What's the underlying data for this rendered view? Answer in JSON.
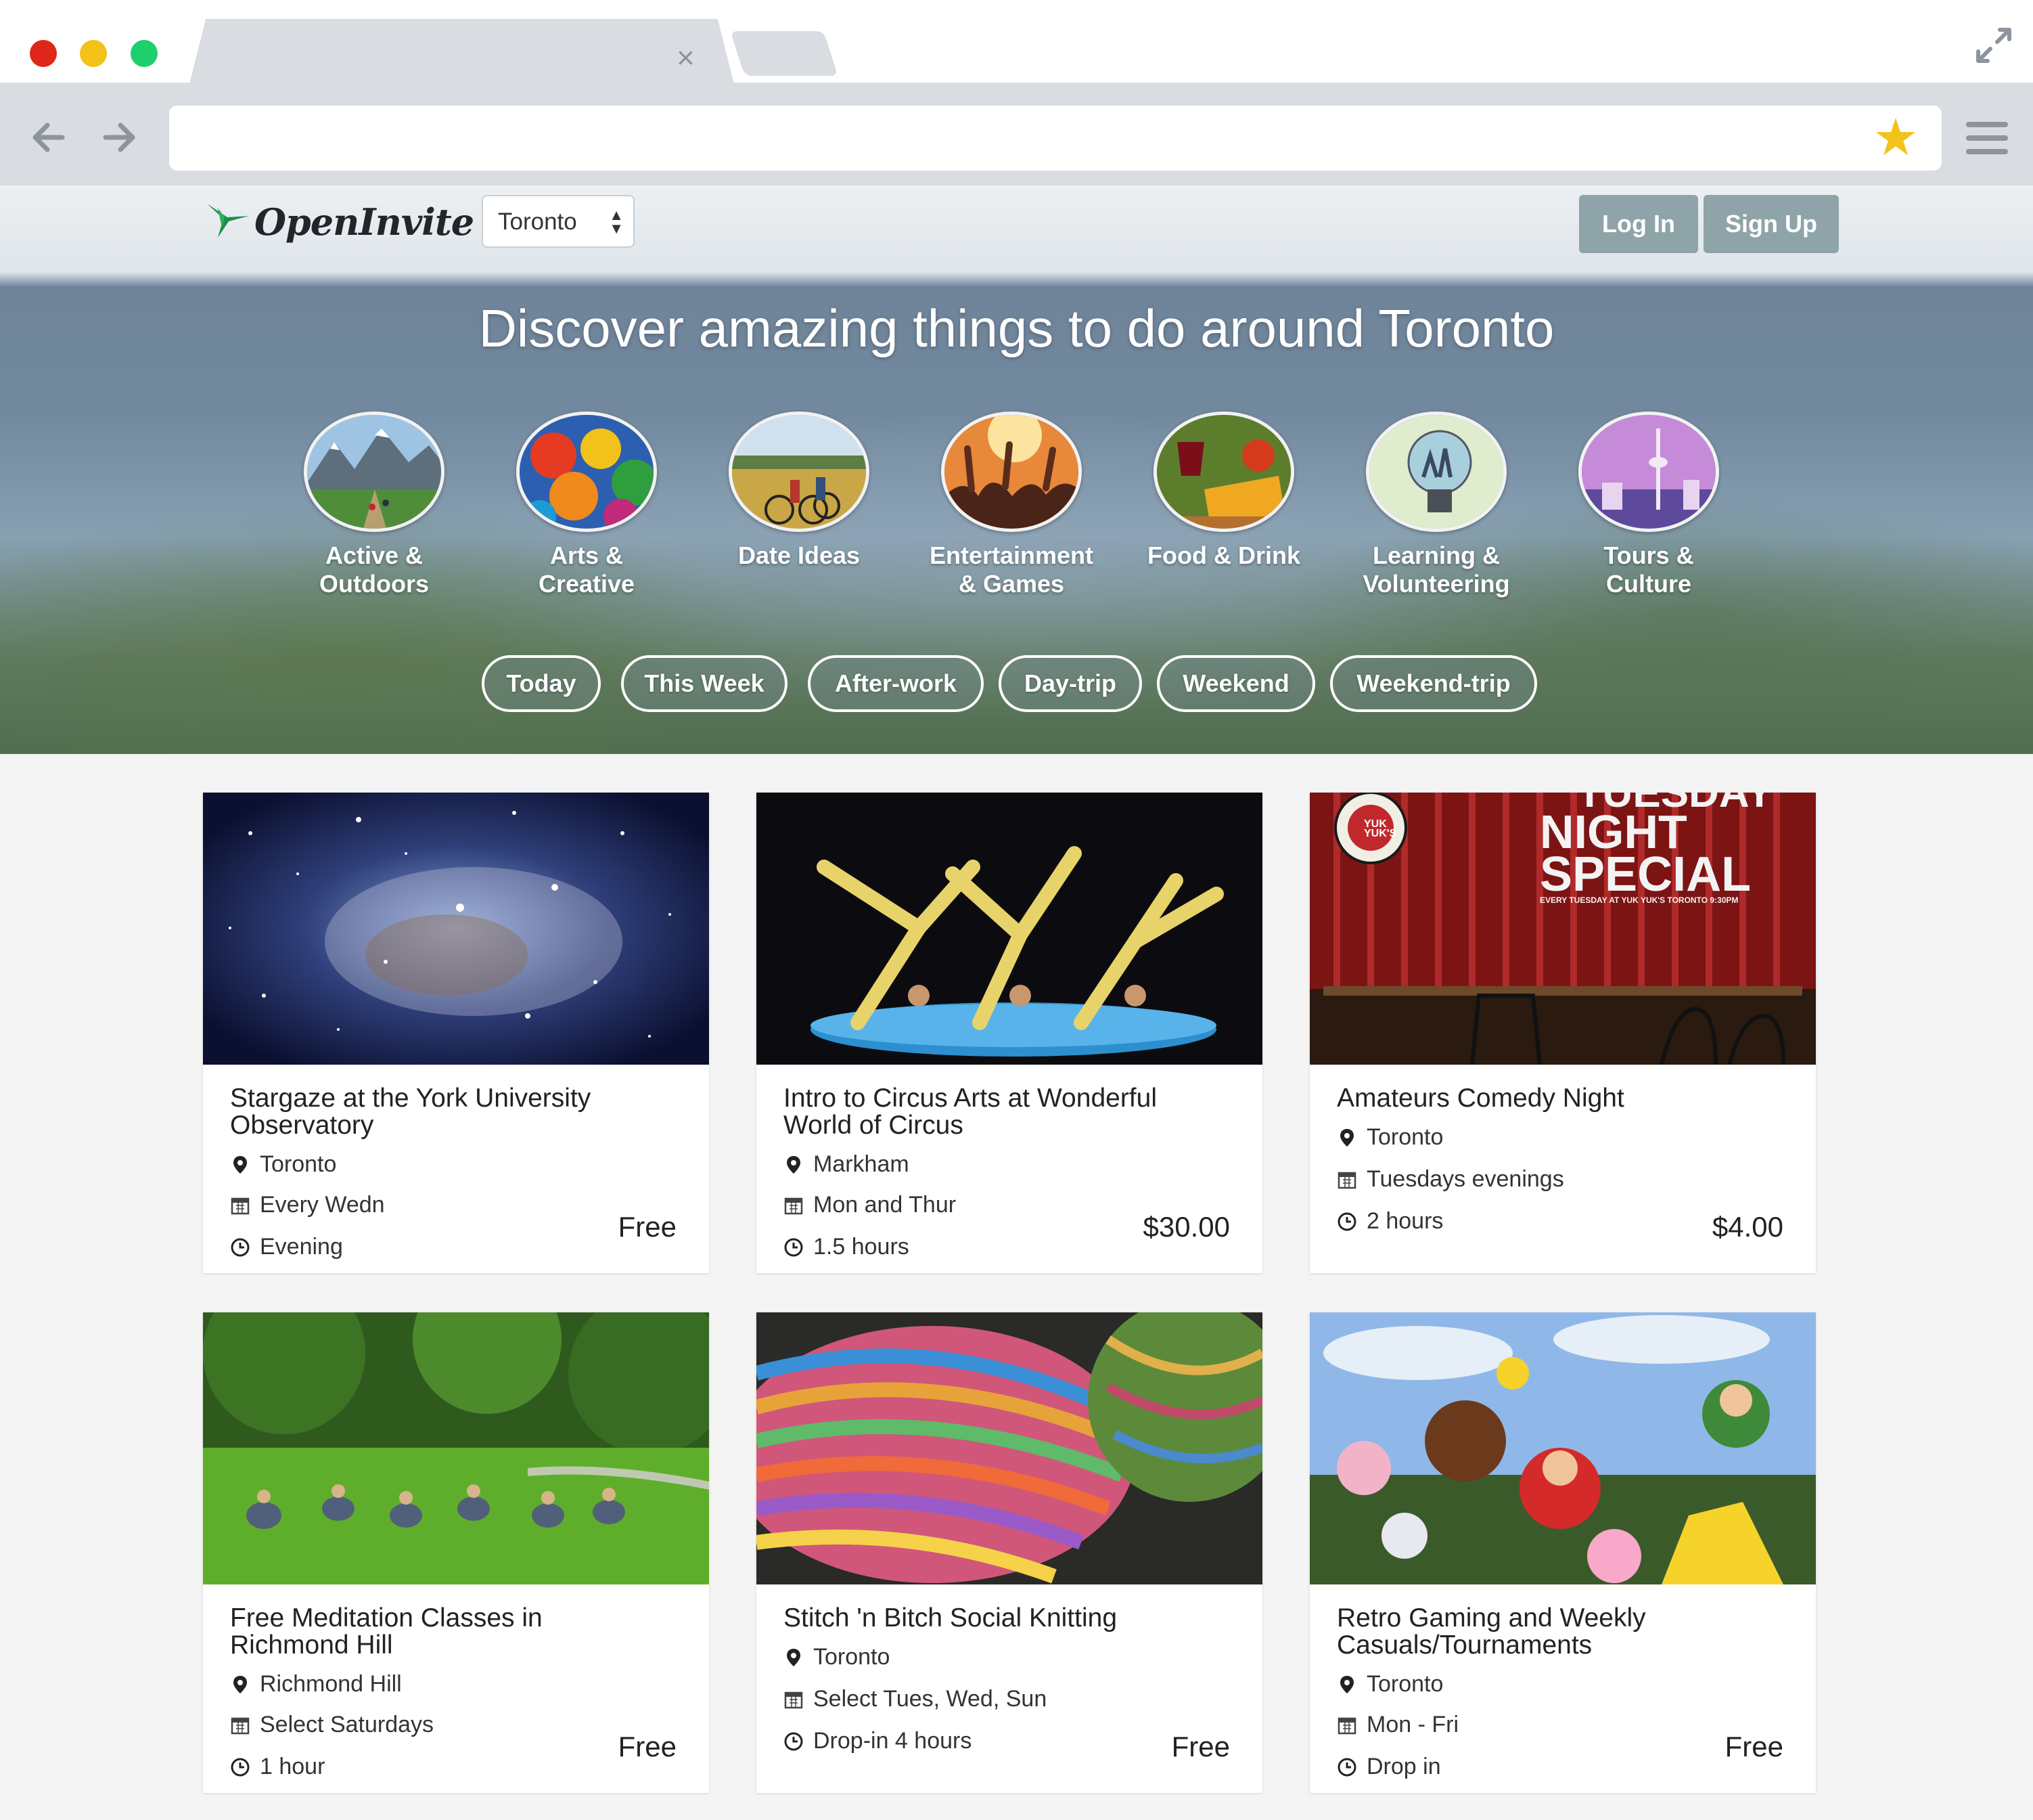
{
  "browser": {
    "tab_close_glyph": "×"
  },
  "header": {
    "logo_text": "OpenInvite",
    "city": "Toronto",
    "login_label": "Log In",
    "signup_label": "Sign Up"
  },
  "hero": {
    "title": "Discover amazing things to do around Toronto",
    "categories": [
      {
        "label": "Active &\nOutdoors",
        "icon": "mountain-icon"
      },
      {
        "label": "Arts &\nCreative",
        "icon": "paint-icon"
      },
      {
        "label": "Date Ideas",
        "icon": "bicycle-icon"
      },
      {
        "label": "Entertainment\n& Games",
        "icon": "concert-icon"
      },
      {
        "label": "Food & Drink",
        "icon": "cheese-wine-icon"
      },
      {
        "label": "Learning &\nVolunteering",
        "icon": "lightbulb-icon"
      },
      {
        "label": "Tours &\nCulture",
        "icon": "cn-tower-icon"
      }
    ],
    "time_filters": [
      "Today",
      "This Week",
      "After-work",
      "Day-trip",
      "Weekend",
      "Weekend-trip"
    ]
  },
  "events": [
    {
      "title": "Stargaze at the York University Observatory",
      "location": "Toronto",
      "schedule": "Every Wedn",
      "duration": "Evening",
      "price": "Free"
    },
    {
      "title": "Intro to Circus Arts at Wonderful World of Circus",
      "location": "Markham",
      "schedule": "Mon and Thur",
      "duration": "1.5 hours",
      "price": "$30.00"
    },
    {
      "title": "Amateurs Comedy Night",
      "location": "Toronto",
      "schedule": "Tuesdays evenings",
      "duration": "2 hours",
      "price": "$4.00"
    },
    {
      "title": "Free Meditation Classes in Richmond Hill",
      "location": "Richmond Hill",
      "schedule": "Select Saturdays",
      "duration": "1 hour",
      "price": "Free"
    },
    {
      "title": "Stitch 'n Bitch Social Knitting",
      "location": "Toronto",
      "schedule": "Select Tues, Wed, Sun",
      "duration": "Drop-in 4 hours",
      "price": "Free"
    },
    {
      "title": "Retro Gaming and Weekly Casuals/Tournaments",
      "location": "Toronto",
      "schedule": "Mon - Fri",
      "duration": "Drop in",
      "price": "Free"
    }
  ],
  "comedy_poster": {
    "headline_top": "TUESDAY",
    "headline_mid": "NIGHT",
    "headline_bottom": "SPECIAL",
    "subline": "EVERY TUESDAY AT YUK YUK'S TORONTO 9:30PM",
    "badge": "YUK YUK'S"
  },
  "colors": {
    "auth_button": "#8fa4a8",
    "star": "#f2c31c",
    "chrome": "#d9dde2"
  }
}
